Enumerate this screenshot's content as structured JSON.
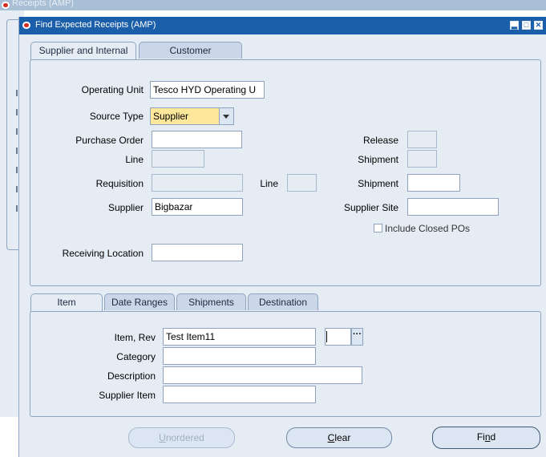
{
  "background_window": {
    "title": "Receipts (AMP)"
  },
  "dialog": {
    "title": "Find Expected Receipts (AMP)"
  },
  "top_tabs": [
    {
      "label": "Supplier and Internal",
      "active": true
    },
    {
      "label": "Customer",
      "active": false
    }
  ],
  "form": {
    "operating_unit": {
      "label": "Operating Unit",
      "value": "Tesco HYD Operating U"
    },
    "source_type": {
      "label": "Source Type",
      "value": "Supplier"
    },
    "purchase_order": {
      "label": "Purchase Order",
      "value": ""
    },
    "release": {
      "label": "Release",
      "value": ""
    },
    "line": {
      "label": "Line",
      "value": ""
    },
    "shipment": {
      "label": "Shipment",
      "value": ""
    },
    "requisition": {
      "label": "Requisition",
      "value": ""
    },
    "req_line": {
      "label": "Line",
      "value": ""
    },
    "req_shipment": {
      "label": "Shipment",
      "value": ""
    },
    "supplier": {
      "label": "Supplier",
      "value": "Bigbazar"
    },
    "supplier_site": {
      "label": "Supplier Site",
      "value": ""
    },
    "include_closed": {
      "label": "Include Closed POs",
      "checked": false
    },
    "receiving_location": {
      "label": "Receiving Location",
      "value": ""
    }
  },
  "bottom_tabs": [
    {
      "label": "Item",
      "active": true
    },
    {
      "label": "Date Ranges",
      "active": false
    },
    {
      "label": "Shipments",
      "active": false
    },
    {
      "label": "Destination",
      "active": false
    }
  ],
  "item": {
    "item_rev": {
      "label": "Item, Rev",
      "value": "Test Item11",
      "rev": ""
    },
    "category": {
      "label": "Category",
      "value": ""
    },
    "description": {
      "label": "Description",
      "value": ""
    },
    "supplier_item": {
      "label": "Supplier Item",
      "value": ""
    }
  },
  "buttons": {
    "unordered": {
      "first": "U",
      "rest": "nordered"
    },
    "clear": {
      "first": "C",
      "rest": "lear"
    },
    "find": {
      "pre": "Fi",
      "u": "n",
      "post": "d"
    }
  },
  "icons": {
    "lov": "ellipsis-icon",
    "dropdown": "chevron-down-icon"
  }
}
